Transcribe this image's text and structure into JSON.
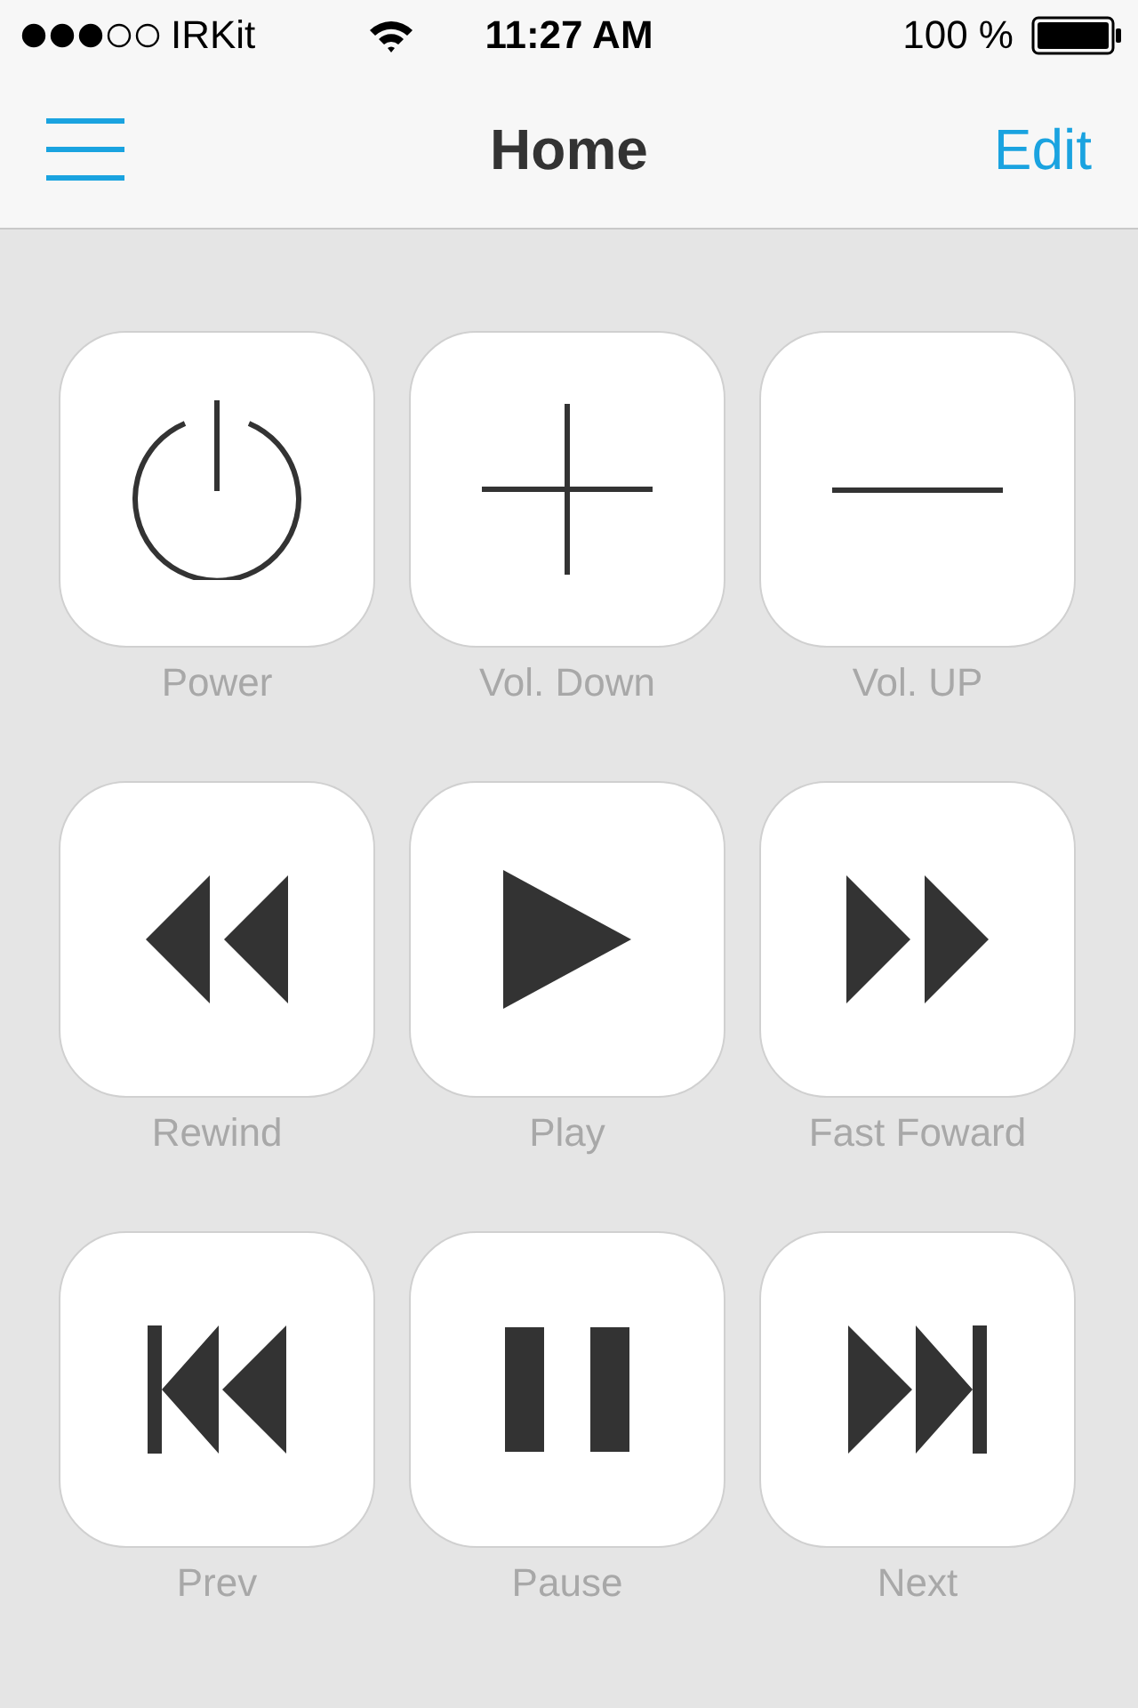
{
  "status_bar": {
    "carrier": "IRKit",
    "time": "11:27 AM",
    "battery": "100 %"
  },
  "nav": {
    "title": "Home",
    "action": "Edit"
  },
  "buttons": [
    {
      "kind": "power",
      "label": "Power"
    },
    {
      "kind": "plus",
      "label": "Vol. Down"
    },
    {
      "kind": "minus",
      "label": "Vol. UP"
    },
    {
      "kind": "rewind",
      "label": "Rewind"
    },
    {
      "kind": "play",
      "label": "Play"
    },
    {
      "kind": "fastforward",
      "label": "Fast Foward"
    },
    {
      "kind": "prev",
      "label": "Prev"
    },
    {
      "kind": "pause",
      "label": "Pause"
    },
    {
      "kind": "next",
      "label": "Next"
    }
  ]
}
